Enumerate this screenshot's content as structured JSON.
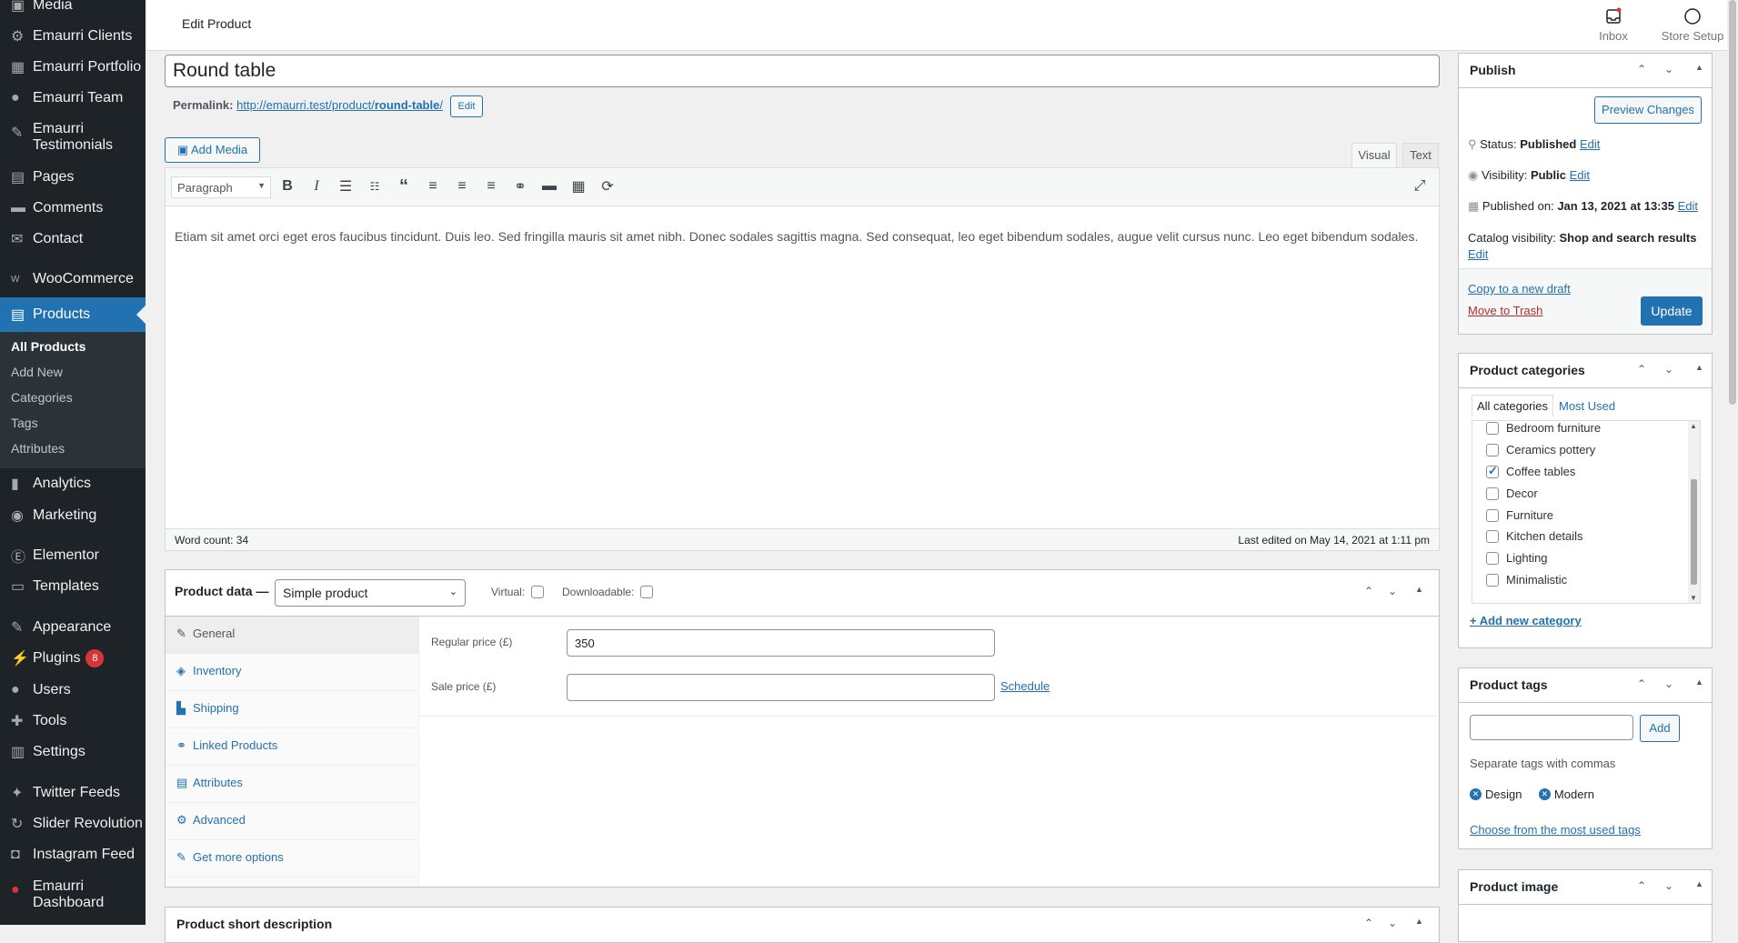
{
  "sidebar": {
    "items": [
      {
        "label": "Media",
        "icon": "media-icon"
      },
      {
        "label": "Emaurri Clients",
        "icon": "clients-icon"
      },
      {
        "label": "Emaurri Portfolio",
        "icon": "portfolio-icon"
      },
      {
        "label": "Emaurri Team",
        "icon": "team-icon"
      },
      {
        "label": "Emaurri Testimonials",
        "icon": "testimonials-icon"
      },
      {
        "label": "Pages",
        "icon": "pages-icon"
      },
      {
        "label": "Comments",
        "icon": "comments-icon"
      },
      {
        "label": "Contact",
        "icon": "contact-icon"
      },
      {
        "label": "WooCommerce",
        "icon": "woocommerce-icon"
      },
      {
        "label": "Products",
        "icon": "products-icon"
      },
      {
        "label": "Analytics",
        "icon": "analytics-icon"
      },
      {
        "label": "Marketing",
        "icon": "marketing-icon"
      },
      {
        "label": "Elementor",
        "icon": "elementor-icon"
      },
      {
        "label": "Templates",
        "icon": "templates-icon"
      },
      {
        "label": "Appearance",
        "icon": "appearance-icon"
      },
      {
        "label": "Plugins",
        "icon": "plugins-icon",
        "badge": "8"
      },
      {
        "label": "Users",
        "icon": "users-icon"
      },
      {
        "label": "Tools",
        "icon": "tools-icon"
      },
      {
        "label": "Settings",
        "icon": "settings-icon"
      },
      {
        "label": "Twitter Feeds",
        "icon": "twitter-icon"
      },
      {
        "label": "Slider Revolution",
        "icon": "slider-revolution-icon"
      },
      {
        "label": "Instagram Feed",
        "icon": "instagram-icon"
      },
      {
        "label": "Emaurri Dashboard",
        "icon": "emaurri-dashboard-icon"
      }
    ],
    "submenu": [
      "All Products",
      "Add New",
      "Categories",
      "Tags",
      "Attributes"
    ]
  },
  "topbar": {
    "page_title": "Edit Product",
    "inbox_label": "Inbox",
    "store_setup_label": "Store Setup"
  },
  "editor": {
    "title_value": "Round table",
    "permalink_label": "Permalink:",
    "permalink_base": "http://emaurri.test/product/",
    "permalink_slug": "round-table",
    "permalink_trail": "/",
    "permalink_edit": "Edit",
    "add_media": "Add Media",
    "tab_visual": "Visual",
    "tab_text": "Text",
    "format_select": "Paragraph",
    "content": "Etiam sit amet orci eget eros faucibus tincidunt. Duis leo. Sed fringilla mauris sit amet nibh. Donec sodales sagittis magna. Sed consequat, leo eget bibendum sodales, augue velit cursus nunc. Leo eget bibendum sodales.",
    "word_count": "Word count: 34",
    "last_edited": "Last edited on May 14, 2021 at 1:11 pm"
  },
  "product_data": {
    "label": "Product data —",
    "type_value": "Simple product",
    "virtual_label": "Virtual:",
    "downloadable_label": "Downloadable:",
    "tabs": [
      "General",
      "Inventory",
      "Shipping",
      "Linked Products",
      "Attributes",
      "Advanced",
      "Get more options"
    ],
    "regular_price_label": "Regular price (£)",
    "regular_price_value": "350",
    "sale_price_label": "Sale price (£)",
    "sale_price_value": "",
    "schedule_link": "Schedule"
  },
  "short_description": {
    "title": "Product short description"
  },
  "publish": {
    "title": "Publish",
    "preview_button": "Preview Changes",
    "status_label": "Status:",
    "status_value": "Published",
    "visibility_label": "Visibility:",
    "visibility_value": "Public",
    "published_on_label": "Published on:",
    "published_on_value": "Jan 13, 2021 at 13:35",
    "edit_link": "Edit",
    "catalog_label": "Catalog visibility:",
    "catalog_value": "Shop and search results",
    "copy_draft": "Copy to a new draft",
    "move_trash": "Move to Trash",
    "update_button": "Update"
  },
  "categories": {
    "title": "Product categories",
    "tab_all": "All categories",
    "tab_most_used": "Most Used",
    "items": [
      {
        "label": "Bedroom furniture",
        "checked": false
      },
      {
        "label": "Ceramics pottery",
        "checked": false
      },
      {
        "label": "Coffee tables",
        "checked": true
      },
      {
        "label": "Decor",
        "checked": false
      },
      {
        "label": "Furniture",
        "checked": false
      },
      {
        "label": "Kitchen details",
        "checked": false
      },
      {
        "label": "Lighting",
        "checked": false
      },
      {
        "label": "Minimalistic",
        "checked": false
      }
    ],
    "add_new": "+ Add new category"
  },
  "tags": {
    "title": "Product tags",
    "input_value": "",
    "add_button": "Add",
    "help": "Separate tags with commas",
    "items": [
      "Design",
      "Modern"
    ],
    "choose_link": "Choose from the most used tags"
  },
  "product_image": {
    "title": "Product image"
  },
  "colors": {
    "accent": "#2271b1",
    "sidebar": "#1d2327",
    "badge": "#d63638"
  }
}
